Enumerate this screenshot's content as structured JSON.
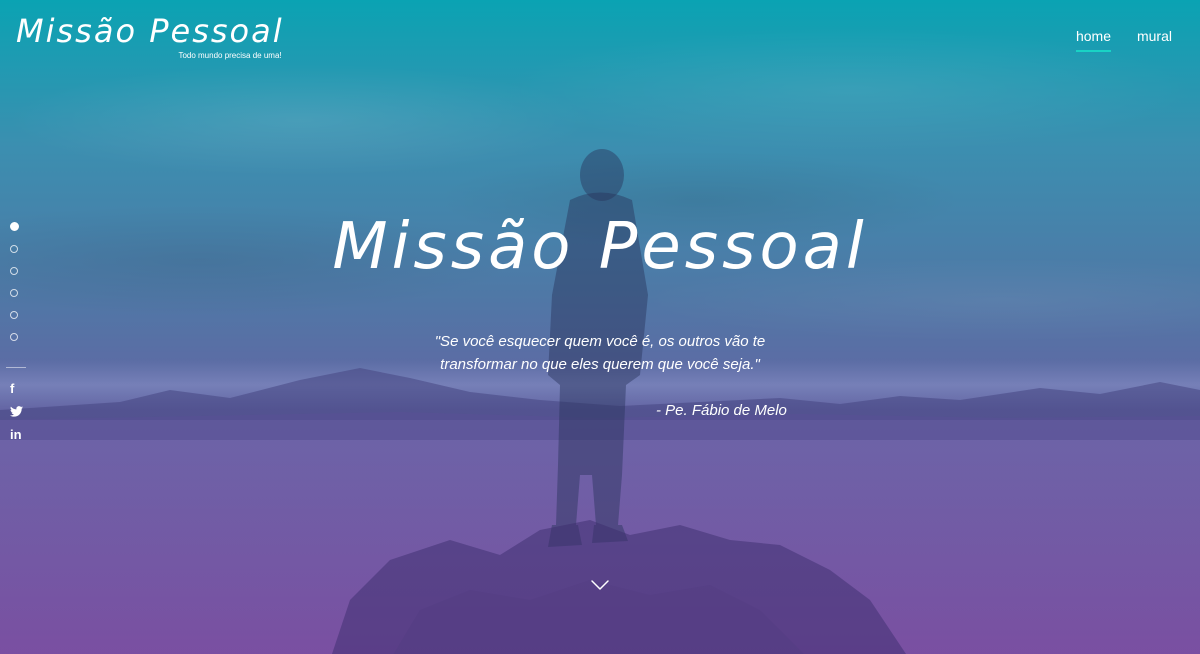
{
  "header": {
    "logo_title": "Missão Pessoal",
    "logo_tagline": "Todo mundo precisa de uma!"
  },
  "nav": {
    "items": [
      {
        "label": "home",
        "active": true
      },
      {
        "label": "mural",
        "active": false
      }
    ]
  },
  "side_nav": {
    "slides": 6,
    "active_slide": 1
  },
  "social": {
    "facebook": "f",
    "linkedin": "in",
    "icons": [
      "facebook-icon",
      "twitter-icon",
      "linkedin-icon"
    ]
  },
  "hero": {
    "headline": "Missão Pessoal",
    "quote_line1": "\"Se você esquecer quem você é, os outros vão te",
    "quote_line2": "transformar no que eles querem que você seja.\"",
    "author": "- Pe. Fábio de Melo"
  },
  "colors": {
    "gradient_top": "#0aa3b3",
    "gradient_bottom": "#7a4fa0",
    "accent": "#19d3c5",
    "text": "#ffffff"
  }
}
